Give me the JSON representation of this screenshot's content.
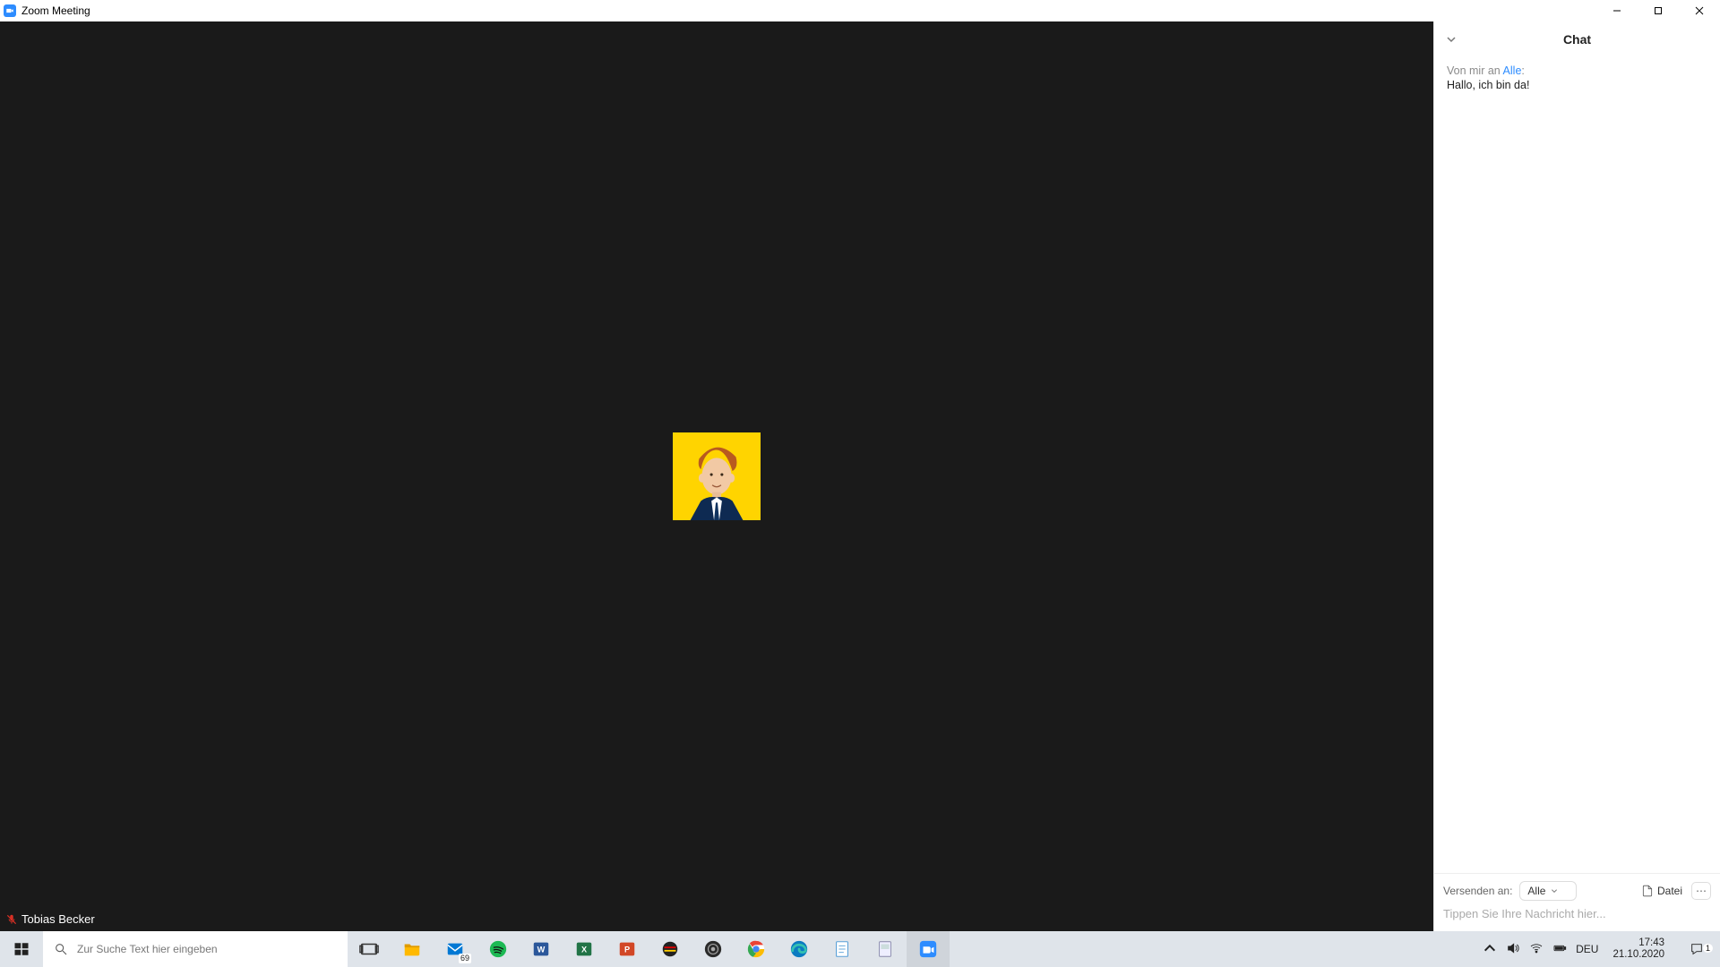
{
  "window": {
    "title": "Zoom Meeting"
  },
  "participant": {
    "name": "Tobias Becker"
  },
  "chat": {
    "title": "Chat",
    "messages": [
      {
        "prefix": "Von mir an ",
        "recipient": "Alle",
        "suffix": ":",
        "text": "Hallo, ich bin da!"
      }
    ],
    "send_to_label": "Versenden an:",
    "send_to_value": "Alle",
    "file_label": "Datei",
    "input_placeholder": "Tippen Sie Ihre Nachricht hier..."
  },
  "taskbar": {
    "search_placeholder": "Zur Suche Text hier eingeben",
    "mail_badge": "69",
    "lang": "DEU",
    "time": "17:43",
    "date": "21.10.2020",
    "notif_count": "1"
  },
  "colors": {
    "accent": "#2d8cff",
    "avatar_bg": "#ffd400"
  }
}
